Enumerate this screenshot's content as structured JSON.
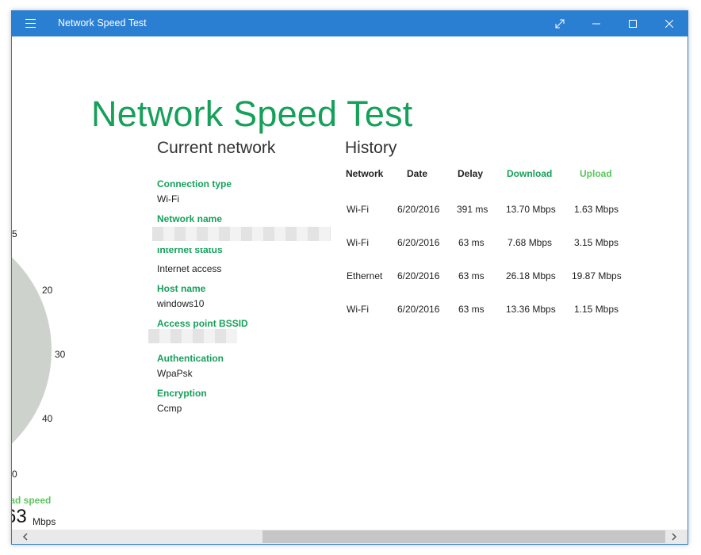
{
  "window": {
    "title": "Network Speed Test"
  },
  "app": {
    "heading": "Network Speed Test"
  },
  "current_network": {
    "title": "Current network",
    "fields": [
      {
        "label": "Connection type",
        "value": "Wi-Fi"
      },
      {
        "label": "Network name",
        "value": ""
      },
      {
        "label": "Internet status",
        "value": "Internet access"
      },
      {
        "label": "Host name",
        "value": "windows10"
      },
      {
        "label": "Access point BSSID",
        "value": ""
      },
      {
        "label": "Authentication",
        "value": "WpaPsk"
      },
      {
        "label": "Encryption",
        "value": "Ccmp"
      }
    ]
  },
  "history": {
    "title": "History",
    "headers": {
      "network": "Network",
      "date": "Date",
      "delay": "Delay",
      "download": "Download",
      "upload": "Upload"
    },
    "rows": [
      {
        "network": "Wi-Fi",
        "date": "6/20/2016",
        "delay": "391 ms",
        "download": "13.70 Mbps",
        "upload": "1.63 Mbps"
      },
      {
        "network": "Wi-Fi",
        "date": "6/20/2016",
        "delay": "63 ms",
        "download": "7.68 Mbps",
        "upload": "3.15 Mbps"
      },
      {
        "network": "Ethernet",
        "date": "6/20/2016",
        "delay": "63 ms",
        "download": "26.18 Mbps",
        "upload": "19.87 Mbps"
      },
      {
        "network": "Wi-Fi",
        "date": "6/20/2016",
        "delay": "63 ms",
        "download": "13.36 Mbps",
        "upload": "1.15 Mbps"
      }
    ]
  },
  "gauge": {
    "ticks": [
      "5",
      "20",
      "30",
      "40",
      "0"
    ],
    "label": "oad speed",
    "value": "63",
    "unit": "Mbps"
  },
  "colors": {
    "titlebar": "#2b7fd3",
    "accent_green": "#16a05a",
    "light_green": "#5cc65c"
  },
  "icons": [
    "hamburger-menu-icon",
    "expand-icon",
    "minimize-icon",
    "maximize-icon",
    "close-icon",
    "chevron-left-icon",
    "chevron-right-icon"
  ]
}
